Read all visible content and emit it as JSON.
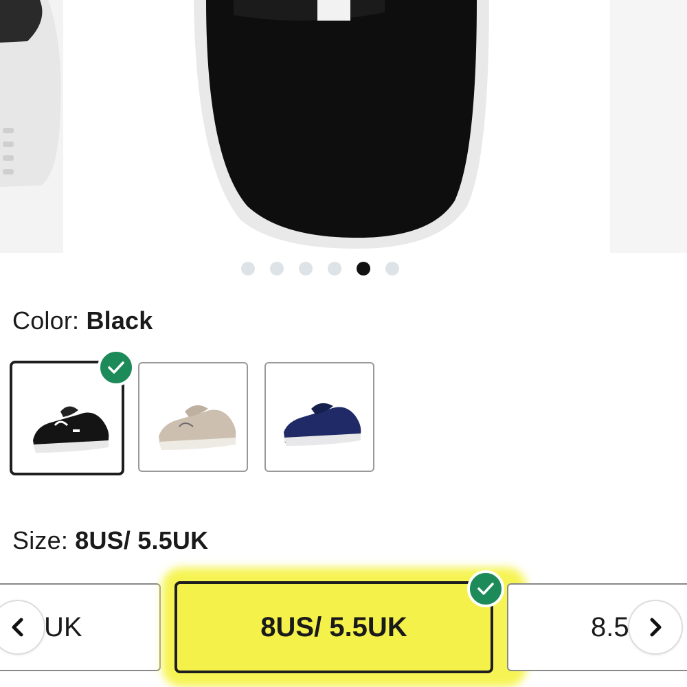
{
  "gallery": {
    "image_icon": "shoe-toe-closeup-black-suede",
    "dots_total": 6,
    "active_dot": 5
  },
  "color": {
    "label": "Color:",
    "value": "Black",
    "swatches": [
      {
        "name": "Black",
        "swatch_color": "#141414",
        "selected": true
      },
      {
        "name": "Beige",
        "swatch_color": "#cdbfaf",
        "selected": false
      },
      {
        "name": "Navy",
        "swatch_color": "#1f2a66",
        "selected": false
      }
    ]
  },
  "size": {
    "label": "Size:",
    "value": "8US/ 5.5UK",
    "options": [
      {
        "label": "UK",
        "selected": false
      },
      {
        "label": "8US/ 5.5UK",
        "selected": true
      },
      {
        "label": "8.5",
        "selected": false
      }
    ],
    "prev_icon": "chevron-left-icon",
    "next_icon": "chevron-right-icon"
  },
  "colors": {
    "check_badge": "#1d8a5a",
    "highlight": "#f4f24a",
    "text": "#1a1a1a"
  }
}
